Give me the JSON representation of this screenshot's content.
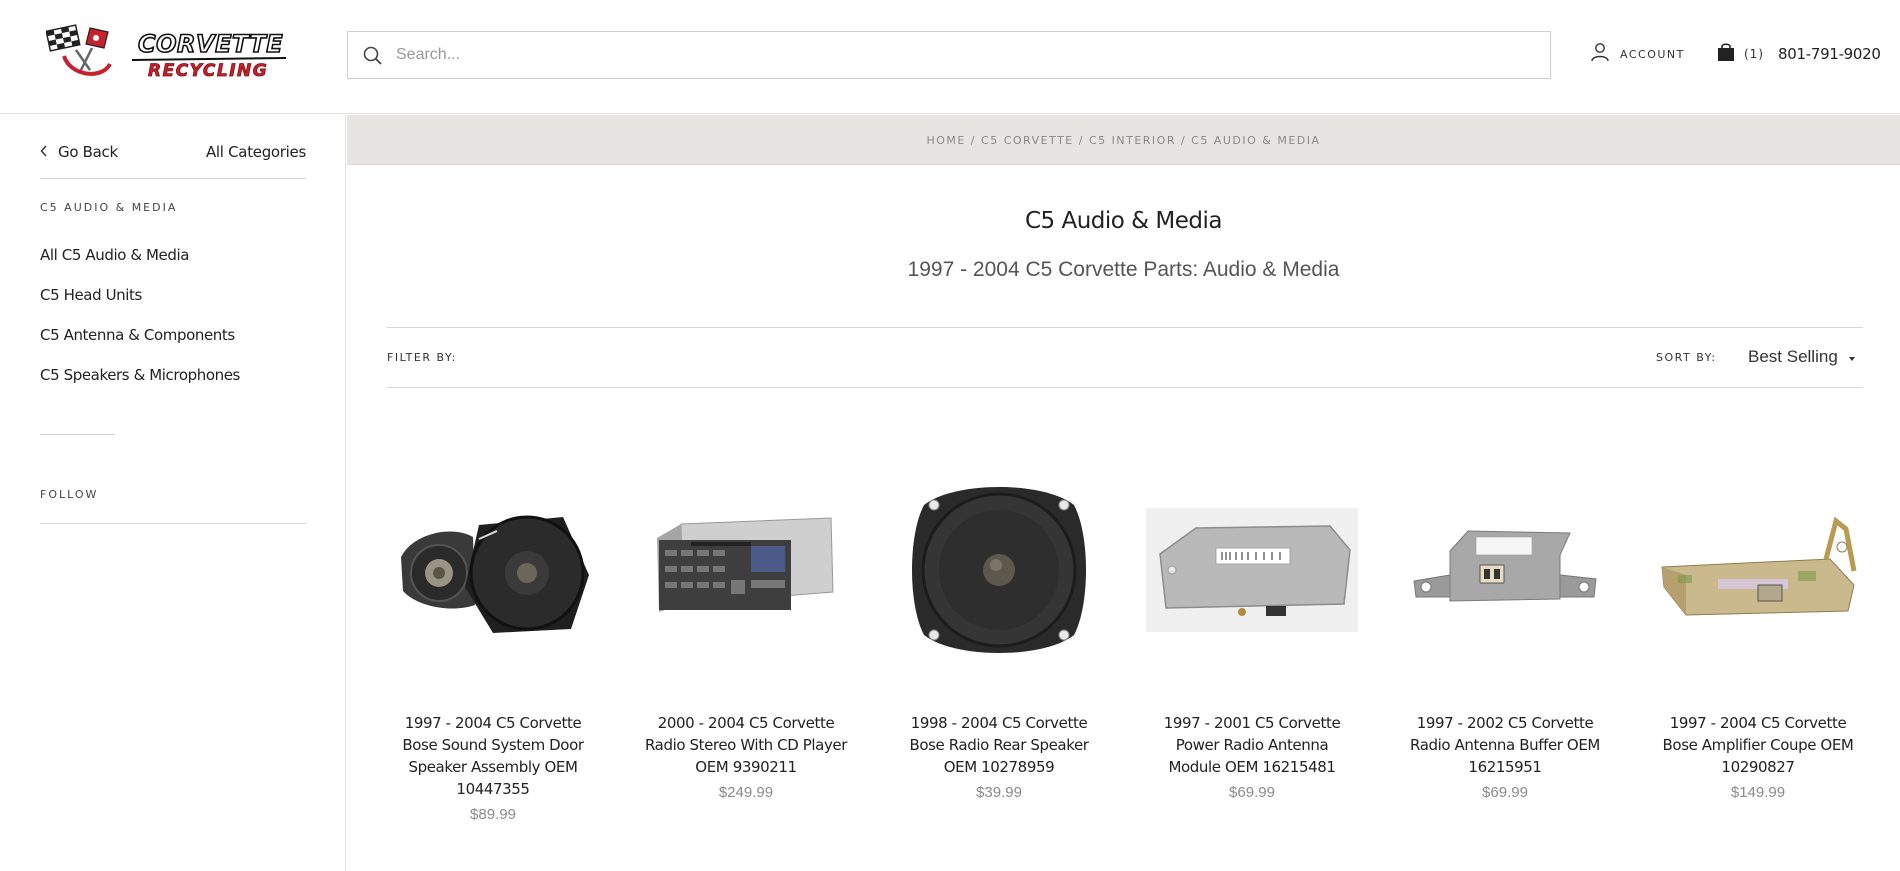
{
  "header": {
    "logo_text_top": "CORVETTE",
    "logo_text_bottom": "RECYCLING",
    "search_placeholder": "Search...",
    "account_label": "ACCOUNT",
    "cart_count": "(1)",
    "phone": "801-791-9020"
  },
  "sidebar": {
    "go_back": "Go Back",
    "all_categories": "All Categories",
    "heading": "C5 AUDIO & MEDIA",
    "items": [
      {
        "label": "All C5 Audio & Media"
      },
      {
        "label": "C5 Head Units"
      },
      {
        "label": "C5 Antenna & Components"
      },
      {
        "label": "C5 Speakers & Microphones"
      }
    ],
    "follow": "FOLLOW"
  },
  "breadcrumb": {
    "items": [
      "HOME",
      "C5 CORVETTE",
      "C5 INTERIOR",
      "C5 AUDIO & MEDIA"
    ],
    "separator": " / "
  },
  "main": {
    "title": "C5 Audio & Media",
    "subtitle": "1997 - 2004 C5 Corvette Parts: Audio & Media",
    "filter_label": "FILTER BY:",
    "sort_label": "SORT BY:",
    "sort_value": "Best Selling"
  },
  "products": [
    {
      "name": "1997 - 2004 C5 Corvette Bose Sound System Door Speaker Assembly OEM 10447355",
      "price": "$89.99",
      "icon": "door-speaker-assembly-image"
    },
    {
      "name": "2000 - 2004 C5 Corvette Radio Stereo With CD Player OEM 9390211",
      "price": "$249.99",
      "icon": "radio-cd-player-image"
    },
    {
      "name": "1998 - 2004 C5 Corvette Bose Radio Rear Speaker OEM 10278959",
      "price": "$39.99",
      "icon": "rear-speaker-image"
    },
    {
      "name": "1997 - 2001 C5 Corvette Power Radio Antenna Module OEM 16215481",
      "price": "$69.99",
      "icon": "antenna-module-image"
    },
    {
      "name": "1997 - 2002 C5 Corvette Radio Antenna Buffer OEM 16215951",
      "price": "$69.99",
      "icon": "antenna-buffer-image"
    },
    {
      "name": "1997 - 2004 C5 Corvette Bose Amplifier Coupe OEM 10290827",
      "price": "$149.99",
      "icon": "amplifier-image"
    }
  ]
}
